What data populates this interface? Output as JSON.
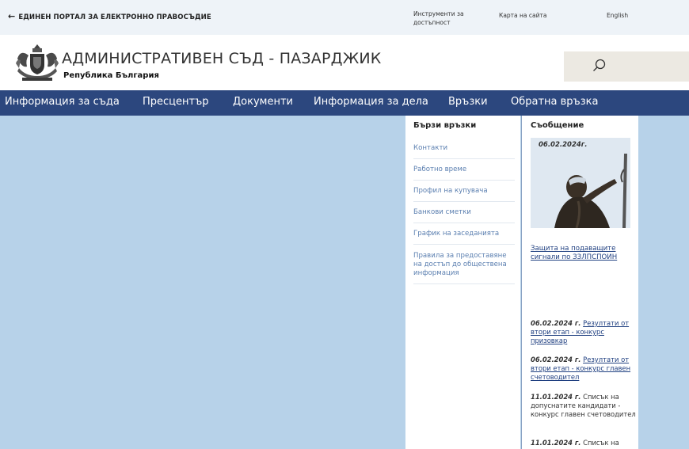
{
  "topbar": {
    "portal_arrow": "←",
    "portal_label": "ЕДИНЕН ПОРТАЛ ЗА ЕЛЕКТРОННО ПРАВОСЪДИЕ",
    "accessibility": "Инструменти за достъпност",
    "sitemap": "Карта на сайта",
    "language": "English"
  },
  "header": {
    "court_name": "АДМИНИСТРАТИВЕН СЪД - ПАЗАРДЖИК",
    "country": "Република България",
    "search_icon": "search-icon"
  },
  "nav": {
    "items": [
      "Информация за съда",
      "Пресцентър",
      "Документи",
      "Информация за дела",
      "Връзки",
      "Обратна връзка"
    ]
  },
  "quick_links": {
    "title": "Бързи връзки",
    "items": [
      "Контакти",
      "Работно време",
      "Профил на купувача",
      "Банкови сметки",
      "График на заседанията",
      "Правила за предоставяне на достъп до обществена информация"
    ]
  },
  "message": {
    "title": "Съобщение",
    "photo_date": "06.02.2024г.",
    "link": "Защита на подаващите сигнали по ЗЗЛПСПОИН"
  },
  "news": [
    {
      "date": "06.02.2024 г.",
      "text": "Резултати от втори етап  - конкурс призовкар",
      "linked": true
    },
    {
      "date": "06.02.2024 г.",
      "text": "Резултати от втори етап  - конкурс главен счетоводител",
      "linked": true
    },
    {
      "date": "11.01.2024 г.",
      "text": "Списък на допуснатите кандидати - конкурс главен счетоводител",
      "linked": false
    },
    {
      "date": "11.01.2024 г.",
      "text": "Списък на",
      "linked": false
    }
  ],
  "colors": {
    "nav_bg": "#2c477e",
    "main_bg": "#b7d2e9",
    "link": "#5b7fb0"
  }
}
